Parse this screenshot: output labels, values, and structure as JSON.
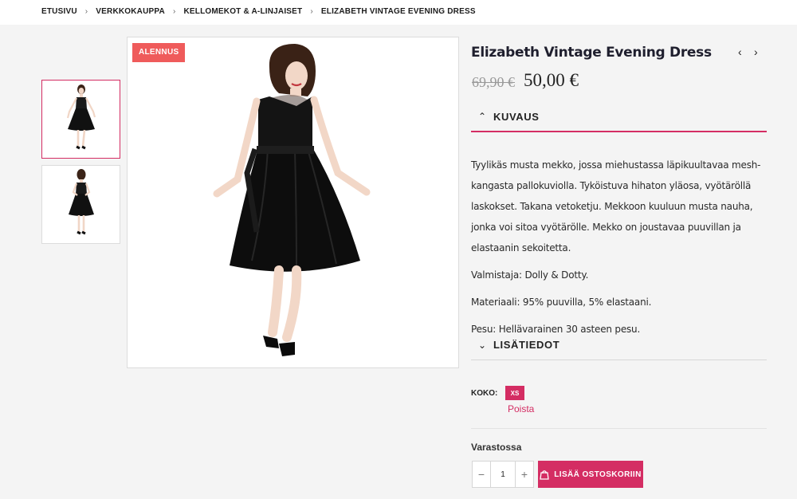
{
  "breadcrumb": {
    "items": [
      "ETUSIVU",
      "VERKKOKAUPPA",
      "KELLOMEKOT & A-LINJAISET",
      "ELIZABETH VINTAGE EVENING DRESS"
    ],
    "separator": "›"
  },
  "gallery": {
    "badge": "ALENNUS",
    "thumbnail_count": 2,
    "active_thumbnail": 0
  },
  "product": {
    "title": "Elizabeth Vintage Evening Dress",
    "old_price": "69,90 €",
    "new_price": "50,00 €"
  },
  "accordion": {
    "description_label": "KUVAUS",
    "description_expanded": true,
    "description_paragraphs": [
      "Tyylikäs musta mekko, jossa miehustassa läpikuultavaa mesh-kangasta pallokuviolla. Tyköistuva hihaton yläosa, vyötäröllä laskokset. Takana vetoketju. Mekkoon kuuluun musta nauha, jonka voi sitoa vyötärölle. Mekko on joustavaa puuvillan ja elastaanin sekoitetta.",
      "Valmistaja: Dolly & Dotty.",
      "Materiaali: 95% puuvilla, 5% elastaani.",
      "Pesu: Hellävarainen 30 asteen pesu."
    ],
    "details_label": "LISÄTIEDOT",
    "details_expanded": false
  },
  "variation": {
    "size_label": "KOKO:",
    "selected_size": "XS",
    "remove_label": "Poista"
  },
  "purchase": {
    "stock_status": "Varastossa",
    "quantity": "1",
    "minus": "−",
    "plus": "+",
    "add_to_cart_label": "LISÄÄ OSTOSKORIIN"
  },
  "colors": {
    "accent": "#d42d63",
    "badge": "#ef5b5b"
  }
}
